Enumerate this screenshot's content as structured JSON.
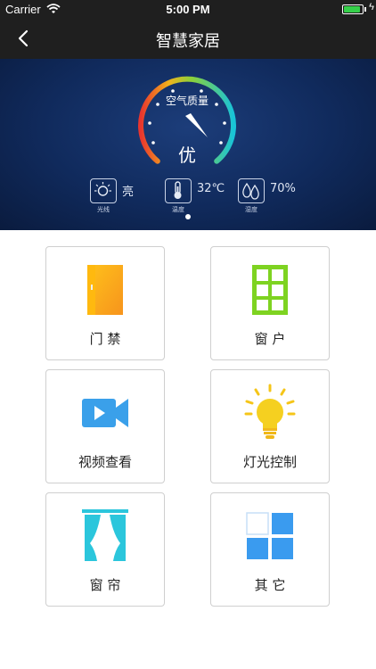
{
  "status_bar": {
    "carrier": "Carrier",
    "time": "5:00 PM",
    "battery_level": 0.9
  },
  "nav": {
    "title": "智慧家居"
  },
  "air_quality": {
    "label": "空气质量",
    "value": "优"
  },
  "sensors": [
    {
      "name": "光线",
      "value": "亮",
      "icon": "sun-icon"
    },
    {
      "name": "温度",
      "value": "32℃",
      "icon": "thermometer-icon"
    },
    {
      "name": "湿度",
      "value": "70%",
      "icon": "humidity-icon"
    }
  ],
  "tiles": [
    {
      "label": "门  禁",
      "icon": "door-icon"
    },
    {
      "label": "窗  户",
      "icon": "window-icon"
    },
    {
      "label": "视频查看",
      "icon": "video-camera-icon"
    },
    {
      "label": "灯光控制",
      "icon": "light-bulb-icon"
    },
    {
      "label": "窗  帘",
      "icon": "curtain-icon"
    },
    {
      "label": "其  它",
      "icon": "grid-icon"
    }
  ],
  "colors": {
    "nav_background": "#1f1f1f",
    "banner_background": "#102a5c",
    "door": "#f7a91c",
    "window": "#7ed321",
    "video": "#3aa0ea",
    "bulb": "#f5d020",
    "curtain": "#2bc6dc",
    "other": "#3a9bef"
  }
}
